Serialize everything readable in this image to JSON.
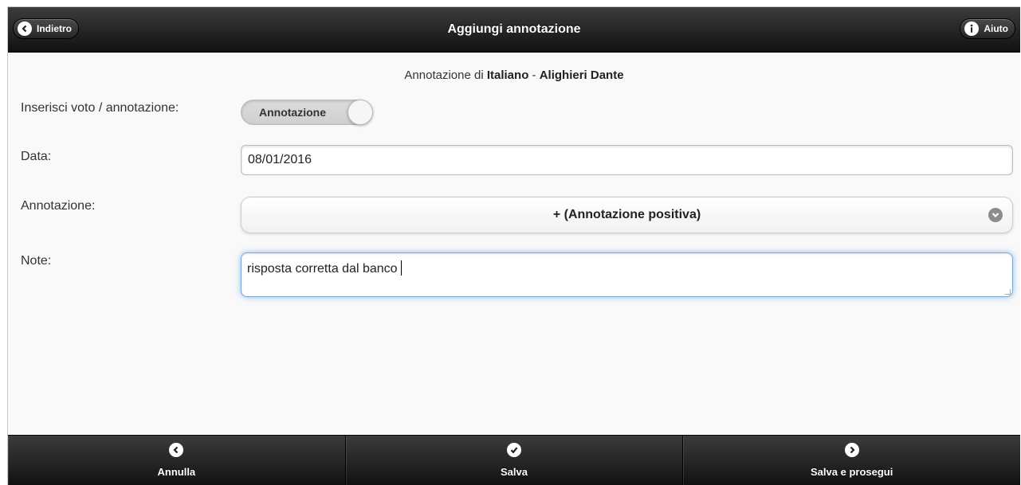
{
  "header": {
    "title": "Aggiungi annotazione",
    "back_label": "Indietro",
    "help_label": "Aiuto"
  },
  "subtitle": {
    "prefix": "Annotazione di ",
    "subject": "Italiano",
    "separator": " - ",
    "student": "Alighieri Dante"
  },
  "form": {
    "type_label": "Inserisci voto / annotazione:",
    "type_toggle_value": "Annotazione",
    "date_label": "Data:",
    "date_value": "08/01/2016",
    "annotation_label": "Annotazione:",
    "annotation_selected": "+ (Annotazione positiva)",
    "note_label": "Note:",
    "note_value": "risposta corretta dal banco"
  },
  "footer": {
    "cancel_label": "Annulla",
    "save_label": "Salva",
    "save_continue_label": "Salva e prosegui"
  },
  "icons": {
    "back": "chevron-left-icon",
    "help": "info-icon",
    "select_arrow": "chevron-down-icon",
    "cancel": "chevron-left-icon",
    "save": "check-icon",
    "save_continue": "chevron-right-icon"
  },
  "colors": {
    "bar_dark": "#111111",
    "focus_blue": "#7fa7d6"
  }
}
